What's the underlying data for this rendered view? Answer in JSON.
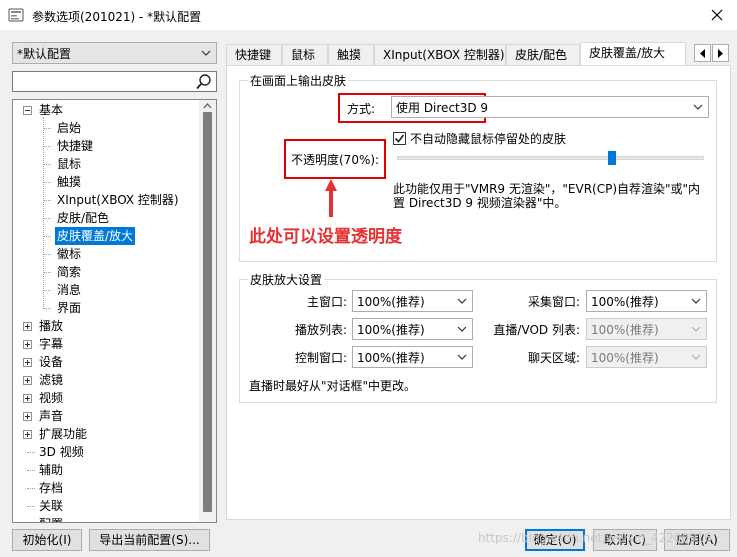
{
  "window": {
    "title": "参数选项(201021) - *默认配置"
  },
  "sidebar": {
    "profile": "*默认配置",
    "tree": [
      {
        "label": "基本",
        "level": 0,
        "expander": "minus"
      },
      {
        "label": "启始",
        "level": 1
      },
      {
        "label": "快捷键",
        "level": 1
      },
      {
        "label": "鼠标",
        "level": 1
      },
      {
        "label": "触摸",
        "level": 1
      },
      {
        "label": "XInput(XBOX 控制器)",
        "level": 1
      },
      {
        "label": "皮肤/配色",
        "level": 1
      },
      {
        "label": "皮肤覆盖/放大",
        "level": 1,
        "selected": true
      },
      {
        "label": "徽标",
        "level": 1
      },
      {
        "label": "简索",
        "level": 1
      },
      {
        "label": "消息",
        "level": 1
      },
      {
        "label": "界面",
        "level": 1
      },
      {
        "label": "播放",
        "level": 0,
        "expander": "plus"
      },
      {
        "label": "字幕",
        "level": 0,
        "expander": "plus"
      },
      {
        "label": "设备",
        "level": 0,
        "expander": "plus"
      },
      {
        "label": "滤镜",
        "level": 0,
        "expander": "plus"
      },
      {
        "label": "视频",
        "level": 0,
        "expander": "plus"
      },
      {
        "label": "声音",
        "level": 0,
        "expander": "plus"
      },
      {
        "label": "扩展功能",
        "level": 0,
        "expander": "plus"
      },
      {
        "label": "3D 视频",
        "level": 0
      },
      {
        "label": "辅助",
        "level": 0
      },
      {
        "label": "存档",
        "level": 0
      },
      {
        "label": "关联",
        "level": 0
      },
      {
        "label": "配置",
        "level": 0
      }
    ]
  },
  "tabs": [
    {
      "label": "快捷键"
    },
    {
      "label": "鼠标"
    },
    {
      "label": "触摸"
    },
    {
      "label": "XInput(XBOX 控制器)"
    },
    {
      "label": "皮肤/配色"
    },
    {
      "label": "皮肤覆盖/放大",
      "active": true
    }
  ],
  "overlay_group": {
    "title": "在画面上输出皮肤",
    "method_label": "方式:",
    "method_value": "使用 Direct3D 9",
    "hide_checkbox_label": "不自动隐藏鼠标停留处的皮肤",
    "hide_checkbox_checked": true,
    "opacity_label": "不透明度(70%):",
    "opacity_value": 0.7,
    "note_line1": "此功能仅用于\"VMR9 无渲染\"，\"EVR(CP)自荐渲染\"或\"内",
    "note_line2": "置 Direct3D 9 视频渲染器\"中。"
  },
  "annotation": {
    "text": "此处可以设置透明度",
    "color": "#e53333"
  },
  "zoom_group": {
    "title": "皮肤放大设置",
    "rows": [
      {
        "left_label": "主窗口:",
        "left_value": "100%(推荐)",
        "right_label": "采集窗口:",
        "right_value": "100%(推荐)",
        "right_enabled": true
      },
      {
        "left_label": "播放列表:",
        "left_value": "100%(推荐)",
        "right_label": "直播/VOD 列表:",
        "right_value": "100%(推荐)",
        "right_enabled": false
      },
      {
        "left_label": "控制窗口:",
        "left_value": "100%(推荐)",
        "right_label": "聊天区域:",
        "right_value": "100%(推荐)",
        "right_enabled": false
      }
    ],
    "footnote": "直播时最好从\"对话框\"中更改。"
  },
  "footer": {
    "reset_label": "初始化(I)",
    "export_label": "导出当前配置(S)...",
    "ok_label": "确定(O)",
    "cancel_label": "取消(C)",
    "apply_label": "应用(A)"
  },
  "watermark": "https://blog.csdn.net/weixin_42200916",
  "colors": {
    "selection": "#0078d7",
    "highlight_box": "#e00000",
    "accent": "#0078d7"
  }
}
